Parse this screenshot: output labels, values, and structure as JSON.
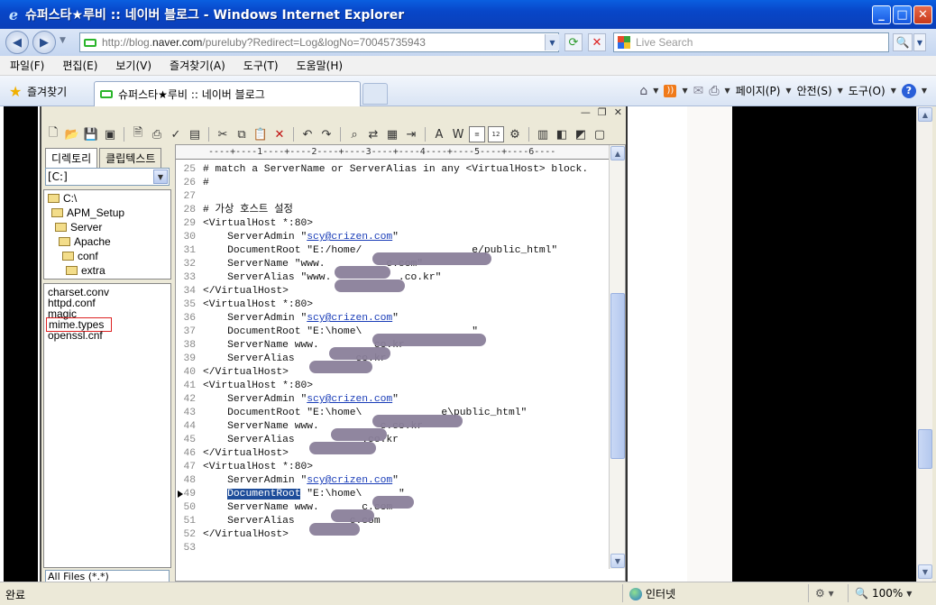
{
  "window": {
    "title": "슈퍼스타★루비 :: 네이버 블로그 - Windows Internet Explorer",
    "minimize": "_",
    "maximize": "□",
    "close": "✕"
  },
  "address": {
    "url_prefix": "http://blog.",
    "url_domain": "naver.com",
    "url_path": "/pureluby?Redirect=Log&logNo=70045735943"
  },
  "search": {
    "placeholder": "Live Search"
  },
  "menu": [
    "파일(F)",
    "편집(E)",
    "보기(V)",
    "즐겨찾기(A)",
    "도구(T)",
    "도움말(H)"
  ],
  "favorites_label": "즐겨찾기",
  "tab": {
    "title": "슈퍼스타★루비 :: 네이버 블로그"
  },
  "commands": {
    "page": "페이지(P)",
    "safety": "안전(S)",
    "tools": "도구(O)"
  },
  "editor_app": {
    "panel_tabs": [
      "디렉토리",
      "클립텍스트"
    ],
    "drive": "[C:]",
    "tree": [
      "C:\\",
      "APM_Setup",
      "Server",
      "Apache",
      "conf",
      "extra"
    ],
    "files": [
      "charset.conv",
      "httpd.conf",
      "magic",
      "mime.types",
      "openssl.cnf"
    ],
    "filter": "All Files (*.*)",
    "ruler": "----+----1----+----2----+----3----+----4----+----5----+----6----",
    "lines": [
      {
        "n": "25",
        "t": "# match a ServerName or ServerAlias in any <VirtualHost> block."
      },
      {
        "n": "26",
        "t": "#"
      },
      {
        "n": "27",
        "t": ""
      },
      {
        "n": "28",
        "t": "# 가상 호스트 설정"
      },
      {
        "n": "29",
        "t": "<VirtualHost *:80>"
      },
      {
        "n": "30",
        "t": "    ServerAdmin \"",
        "link": "scy@crizen.com",
        "after": "\""
      },
      {
        "n": "31",
        "t": "    DocumentRoot \"E:/home/                  e/public_html\""
      },
      {
        "n": "32",
        "t": "    ServerName \"www.          c.com\""
      },
      {
        "n": "33",
        "t": "    ServerAlias \"www.           .co.kr\""
      },
      {
        "n": "34",
        "t": "</VirtualHost>"
      },
      {
        "n": "35",
        "t": "<VirtualHost *:80>"
      },
      {
        "n": "36",
        "t": "    ServerAdmin \"",
        "link": "scy@crizen.com",
        "after": "\""
      },
      {
        "n": "37",
        "t": "    DocumentRoot \"E:\\home\\                  \""
      },
      {
        "n": "38",
        "t": "    ServerName www.         co.kr"
      },
      {
        "n": "39",
        "t": "    ServerAlias          co.kr"
      },
      {
        "n": "40",
        "t": "</VirtualHost>"
      },
      {
        "n": "41",
        "t": "<VirtualHost *:80>"
      },
      {
        "n": "42",
        "t": "    ServerAdmin \"",
        "link": "scy@crizen.com",
        "after": "\""
      },
      {
        "n": "43",
        "t": "    DocumentRoot \"E:\\home\\             e\\public_html\""
      },
      {
        "n": "44",
        "t": "    ServerName www.          c.co.kr"
      },
      {
        "n": "45",
        "t": "    ServerAlias           .co.kr"
      },
      {
        "n": "46",
        "t": "</VirtualHost>"
      },
      {
        "n": "47",
        "t": "<VirtualHost *:80>"
      },
      {
        "n": "48",
        "t": "    ServerAdmin \"",
        "link": "scy@crizen.com",
        "after": "\""
      },
      {
        "n": "49",
        "t": "    ",
        "sel": "DocumentRoot",
        "after": " \"E:\\home\\      \""
      },
      {
        "n": "50",
        "t": "    ServerName www.       c.com"
      },
      {
        "n": "51",
        "t": "    ServerAlias         c.com"
      },
      {
        "n": "52",
        "t": "</VirtualHost>"
      },
      {
        "n": "53",
        "t": ""
      }
    ]
  },
  "status": {
    "text": "완료",
    "zone": "인터넷",
    "zoom": "100%"
  }
}
